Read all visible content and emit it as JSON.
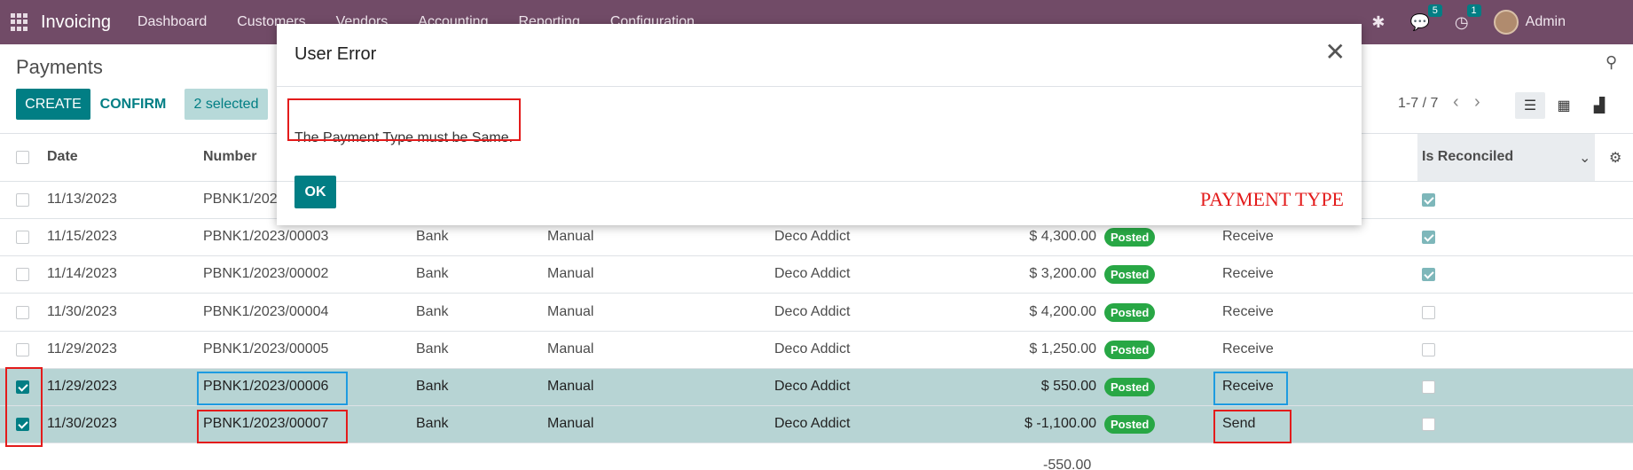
{
  "navbar": {
    "brand": "Invoicing",
    "menu": [
      "Dashboard",
      "Customers",
      "Vendors",
      "Accounting",
      "Reporting",
      "Configuration"
    ],
    "messages_count": "5",
    "activities_count": "1",
    "user": "Admin"
  },
  "control_panel": {
    "title": "Payments",
    "create_label": "CREATE",
    "confirm_label": "CONFIRM",
    "selected_label": "2 selected",
    "pager": "1-7 / 7"
  },
  "table": {
    "headers": {
      "date": "Date",
      "number": "Number",
      "is_reconciled": "Is Reconciled"
    },
    "rows": [
      {
        "date": "11/13/2023",
        "number": "PBNK1/2023/00001",
        "journal": "",
        "method": "",
        "partner": "",
        "amount": "",
        "status": "",
        "type": "",
        "reconciled": true,
        "selected": false
      },
      {
        "date": "11/15/2023",
        "number": "PBNK1/2023/00003",
        "journal": "Bank",
        "method": "Manual",
        "partner": "Deco Addict",
        "amount": "$ 4,300.00",
        "status": "Posted",
        "type": "Receive",
        "reconciled": true,
        "selected": false
      },
      {
        "date": "11/14/2023",
        "number": "PBNK1/2023/00002",
        "journal": "Bank",
        "method": "Manual",
        "partner": "Deco Addict",
        "amount": "$ 3,200.00",
        "status": "Posted",
        "type": "Receive",
        "reconciled": true,
        "selected": false
      },
      {
        "date": "11/30/2023",
        "number": "PBNK1/2023/00004",
        "journal": "Bank",
        "method": "Manual",
        "partner": "Deco Addict",
        "amount": "$ 4,200.00",
        "status": "Posted",
        "type": "Receive",
        "reconciled": false,
        "selected": false
      },
      {
        "date": "11/29/2023",
        "number": "PBNK1/2023/00005",
        "journal": "Bank",
        "method": "Manual",
        "partner": "Deco Addict",
        "amount": "$ 1,250.00",
        "status": "Posted",
        "type": "Receive",
        "reconciled": false,
        "selected": false
      },
      {
        "date": "11/29/2023",
        "number": "PBNK1/2023/00006",
        "journal": "Bank",
        "method": "Manual",
        "partner": "Deco Addict",
        "amount": "$ 550.00",
        "status": "Posted",
        "type": "Receive",
        "reconciled": false,
        "selected": true
      },
      {
        "date": "11/30/2023",
        "number": "PBNK1/2023/00007",
        "journal": "Bank",
        "method": "Manual",
        "partner": "Deco Addict",
        "amount": "$ -1,100.00",
        "status": "Posted",
        "type": "Send",
        "reconciled": false,
        "selected": true
      }
    ],
    "total": "-550.00"
  },
  "modal": {
    "title": "User Error",
    "message": "The Payment Type must be Same.",
    "ok_label": "OK",
    "annotation": "PAYMENT TYPE"
  },
  "colors": {
    "navbar": "#714b67",
    "primary": "#017e84",
    "posted": "#28a745",
    "annotation_red": "#e31b1b",
    "annotation_blue": "#1e9be0"
  }
}
